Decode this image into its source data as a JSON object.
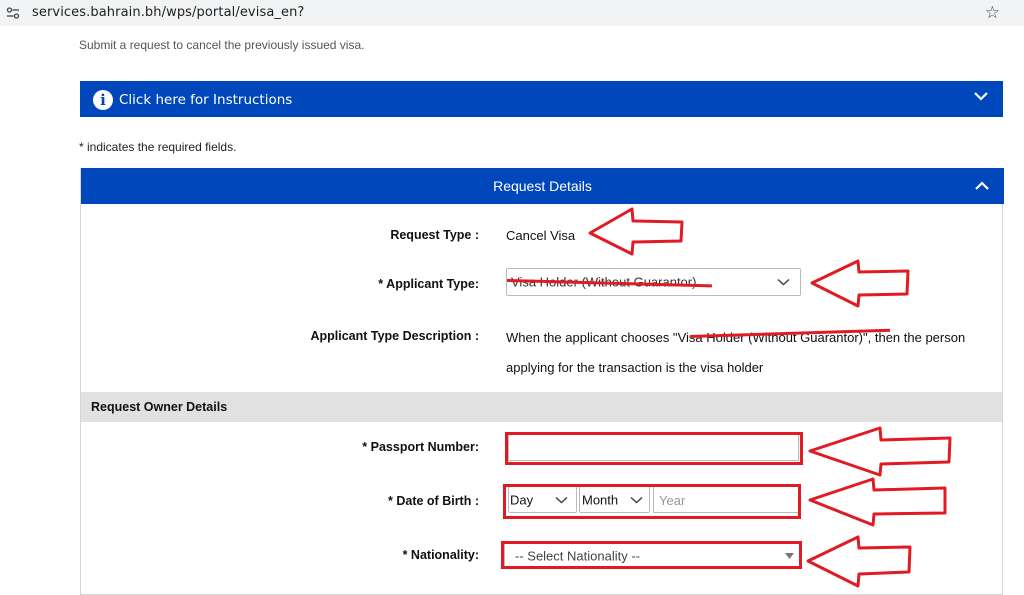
{
  "browser": {
    "url": "services.bahrain.bh/wps/portal/evisa_en?",
    "site_icon": "tune-icon",
    "bookmark_icon": "star-icon"
  },
  "page": {
    "subtitle": "Submit a request to cancel the previously issued visa.",
    "instructions_label": "Click here for Instructions",
    "required_note": "* indicates the required fields.",
    "accent_color": "#0047bb",
    "annotation_color": "#e01b24"
  },
  "request_details": {
    "title": "Request Details",
    "request_type_label": "Request Type :",
    "request_type_value": "Cancel Visa",
    "applicant_type_label": "* Applicant Type:",
    "applicant_type_value": "Visa Holder (Without Guarantor)",
    "applicant_desc_label": "Applicant Type Description :",
    "applicant_desc_line1_prefix": "When the applicant chooses \"",
    "applicant_desc_line1_struck": "Visa Holder (Without Guarantor)",
    "applicant_desc_line1_suffix": "\", then the person",
    "applicant_desc_line2": "applying for the transaction is the visa holder"
  },
  "owner_details": {
    "title": "Request Owner Details",
    "passport_label": "* Passport Number:",
    "passport_value": "",
    "dob_label": "* Date of Birth :",
    "dob_day": "Day",
    "dob_month": "Month",
    "dob_year_placeholder": "Year",
    "nationality_label": "* Nationality:",
    "nationality_value": "-- Select Nationality --"
  }
}
